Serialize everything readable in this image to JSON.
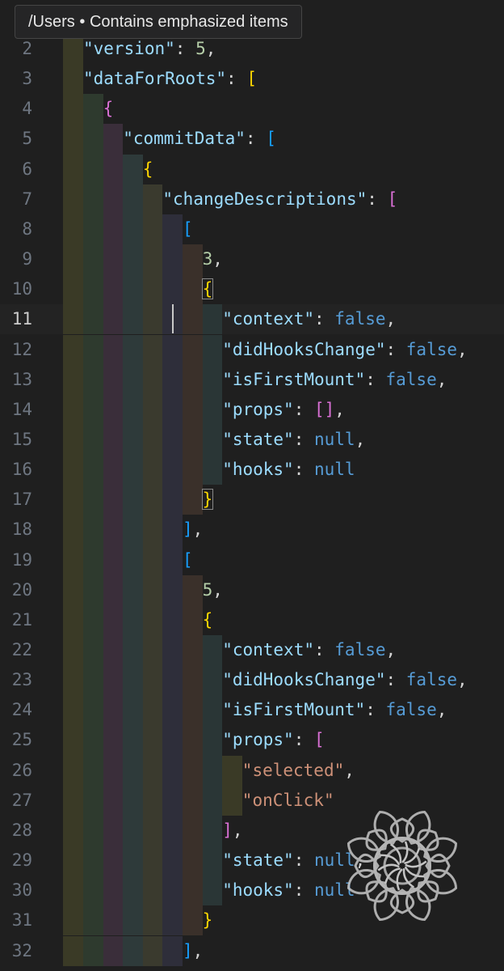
{
  "breadcrumb": {
    "path": "/Users",
    "separator": "•",
    "status": "Contains emphasized items"
  },
  "editor": {
    "current_line": 11,
    "lines": [
      {
        "n": "2",
        "indent": 1,
        "tokens": [
          {
            "c": "k",
            "t": "\"version\""
          },
          {
            "c": "p",
            "t": ": "
          },
          {
            "c": "n",
            "t": "5"
          },
          {
            "c": "p",
            "t": ","
          }
        ]
      },
      {
        "n": "3",
        "indent": 1,
        "tokens": [
          {
            "c": "k",
            "t": "\"dataForRoots\""
          },
          {
            "c": "p",
            "t": ": "
          },
          {
            "c": "b",
            "t": "["
          }
        ]
      },
      {
        "n": "4",
        "indent": 2,
        "tokens": [
          {
            "c": "b",
            "t": "{"
          }
        ]
      },
      {
        "n": "5",
        "indent": 3,
        "tokens": [
          {
            "c": "k",
            "t": "\"commitData\""
          },
          {
            "c": "p",
            "t": ": "
          },
          {
            "c": "b",
            "t": "["
          }
        ]
      },
      {
        "n": "6",
        "indent": 4,
        "tokens": [
          {
            "c": "b",
            "t": "{"
          }
        ]
      },
      {
        "n": "7",
        "indent": 5,
        "tokens": [
          {
            "c": "k",
            "t": "\"changeDescriptions\""
          },
          {
            "c": "p",
            "t": ": "
          },
          {
            "c": "b",
            "t": "["
          }
        ]
      },
      {
        "n": "8",
        "indent": 6,
        "tokens": [
          {
            "c": "b",
            "t": "["
          }
        ]
      },
      {
        "n": "9",
        "indent": 7,
        "tokens": [
          {
            "c": "n",
            "t": "3"
          },
          {
            "c": "p",
            "t": ","
          }
        ]
      },
      {
        "n": "10",
        "indent": 7,
        "tokens": [
          {
            "c": "b",
            "t": "{",
            "box": true
          }
        ]
      },
      {
        "n": "11",
        "indent": 8,
        "tokens": [
          {
            "c": "k",
            "t": "\"context\""
          },
          {
            "c": "p",
            "t": ": "
          },
          {
            "c": "b",
            "t": "false"
          },
          {
            "c": "p",
            "t": ","
          }
        ]
      },
      {
        "n": "12",
        "indent": 8,
        "tokens": [
          {
            "c": "k",
            "t": "\"didHooksChange\""
          },
          {
            "c": "p",
            "t": ": "
          },
          {
            "c": "b",
            "t": "false"
          },
          {
            "c": "p",
            "t": ","
          }
        ]
      },
      {
        "n": "13",
        "indent": 8,
        "tokens": [
          {
            "c": "k",
            "t": "\"isFirstMount\""
          },
          {
            "c": "p",
            "t": ": "
          },
          {
            "c": "b",
            "t": "false"
          },
          {
            "c": "p",
            "t": ","
          }
        ]
      },
      {
        "n": "14",
        "indent": 8,
        "tokens": [
          {
            "c": "k",
            "t": "\"props\""
          },
          {
            "c": "p",
            "t": ": "
          },
          {
            "c": "b",
            "t": "[]"
          },
          {
            "c": "p",
            "t": ","
          }
        ]
      },
      {
        "n": "15",
        "indent": 8,
        "tokens": [
          {
            "c": "k",
            "t": "\"state\""
          },
          {
            "c": "p",
            "t": ": "
          },
          {
            "c": "b",
            "t": "null"
          },
          {
            "c": "p",
            "t": ","
          }
        ]
      },
      {
        "n": "16",
        "indent": 8,
        "tokens": [
          {
            "c": "k",
            "t": "\"hooks\""
          },
          {
            "c": "p",
            "t": ": "
          },
          {
            "c": "b",
            "t": "null"
          }
        ]
      },
      {
        "n": "17",
        "indent": 7,
        "tokens": [
          {
            "c": "b",
            "t": "}",
            "box": true
          }
        ]
      },
      {
        "n": "18",
        "indent": 6,
        "tokens": [
          {
            "c": "b",
            "t": "]"
          },
          {
            "c": "p",
            "t": ","
          }
        ]
      },
      {
        "n": "19",
        "indent": 6,
        "tokens": [
          {
            "c": "b",
            "t": "["
          }
        ]
      },
      {
        "n": "20",
        "indent": 7,
        "tokens": [
          {
            "c": "n",
            "t": "5"
          },
          {
            "c": "p",
            "t": ","
          }
        ]
      },
      {
        "n": "21",
        "indent": 7,
        "tokens": [
          {
            "c": "b",
            "t": "{"
          }
        ]
      },
      {
        "n": "22",
        "indent": 8,
        "tokens": [
          {
            "c": "k",
            "t": "\"context\""
          },
          {
            "c": "p",
            "t": ": "
          },
          {
            "c": "b",
            "t": "false"
          },
          {
            "c": "p",
            "t": ","
          }
        ]
      },
      {
        "n": "23",
        "indent": 8,
        "tokens": [
          {
            "c": "k",
            "t": "\"didHooksChange\""
          },
          {
            "c": "p",
            "t": ": "
          },
          {
            "c": "b",
            "t": "false"
          },
          {
            "c": "p",
            "t": ","
          }
        ]
      },
      {
        "n": "24",
        "indent": 8,
        "tokens": [
          {
            "c": "k",
            "t": "\"isFirstMount\""
          },
          {
            "c": "p",
            "t": ": "
          },
          {
            "c": "b",
            "t": "false"
          },
          {
            "c": "p",
            "t": ","
          }
        ]
      },
      {
        "n": "25",
        "indent": 8,
        "tokens": [
          {
            "c": "k",
            "t": "\"props\""
          },
          {
            "c": "p",
            "t": ": "
          },
          {
            "c": "b",
            "t": "["
          }
        ]
      },
      {
        "n": "26",
        "indent": 9,
        "tokens": [
          {
            "c": "s",
            "t": "\"selected\""
          },
          {
            "c": "p",
            "t": ","
          }
        ]
      },
      {
        "n": "27",
        "indent": 9,
        "tokens": [
          {
            "c": "s",
            "t": "\"onClick\""
          }
        ]
      },
      {
        "n": "28",
        "indent": 8,
        "tokens": [
          {
            "c": "b",
            "t": "]"
          },
          {
            "c": "p",
            "t": ","
          }
        ]
      },
      {
        "n": "29",
        "indent": 8,
        "tokens": [
          {
            "c": "k",
            "t": "\"state\""
          },
          {
            "c": "p",
            "t": ": "
          },
          {
            "c": "b",
            "t": "null"
          },
          {
            "c": "p",
            "t": ","
          }
        ]
      },
      {
        "n": "30",
        "indent": 8,
        "tokens": [
          {
            "c": "k",
            "t": "\"hooks\""
          },
          {
            "c": "p",
            "t": ": "
          },
          {
            "c": "b",
            "t": "null"
          }
        ]
      },
      {
        "n": "31",
        "indent": 7,
        "tokens": [
          {
            "c": "b",
            "t": "}"
          }
        ]
      },
      {
        "n": "32",
        "indent": 6,
        "tokens": [
          {
            "c": "b",
            "t": "]"
          },
          {
            "c": "p",
            "t": ","
          }
        ]
      }
    ]
  },
  "colors": {
    "key": "#9cdcfe",
    "string": "#ce9178",
    "number": "#b5cea8",
    "keyword": "#569cd6",
    "bracket_colors": [
      "#ffd700",
      "#da70d6",
      "#179fff"
    ],
    "guide_colors": [
      "#3a3a26",
      "#2e3a2e",
      "#3a2e3a",
      "#2e3a3a",
      "#3a3a2e",
      "#2e2e3a",
      "#3a302a",
      "#2a3636"
    ]
  },
  "icons": {
    "watermark": "lotus-mandala-watermark"
  }
}
